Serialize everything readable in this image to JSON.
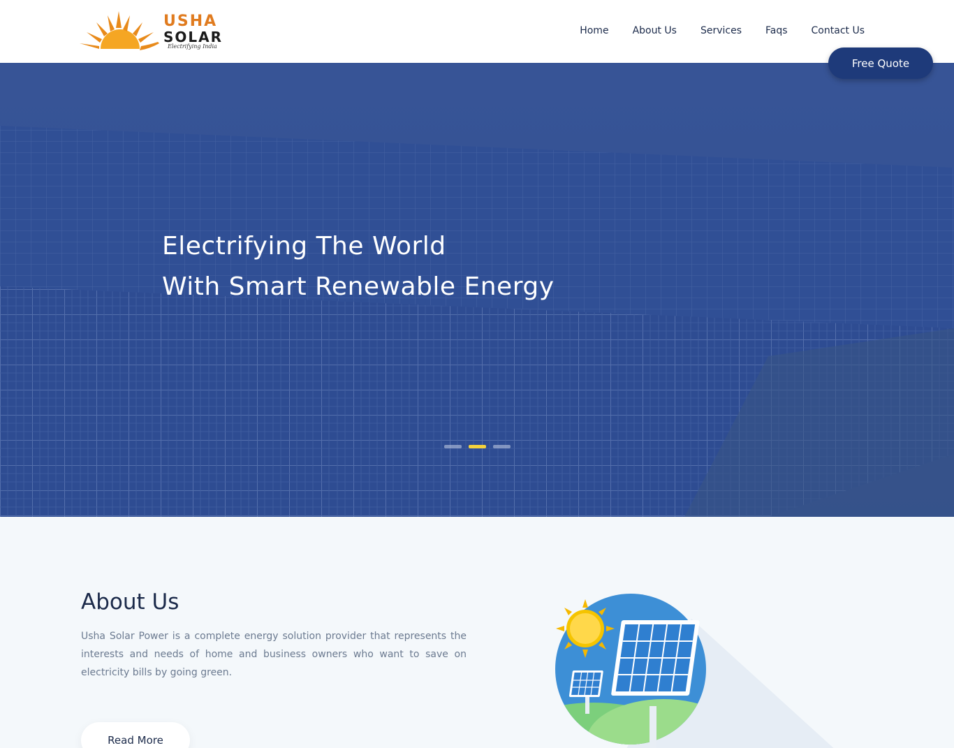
{
  "header": {
    "logo": {
      "brand_top": "USHA",
      "brand_bottom": "SOLAR",
      "tagline": "Electrifying India",
      "icon": "sun-logo-icon"
    },
    "nav": [
      {
        "label": "Home"
      },
      {
        "label": "About Us"
      },
      {
        "label": "Services"
      },
      {
        "label": "Faqs"
      },
      {
        "label": "Contact Us"
      }
    ],
    "quote_button": "Free Quote"
  },
  "hero": {
    "line1": "Electrifying The World",
    "line2": "With Smart Renewable Energy",
    "slides": 3,
    "active_slide": 2
  },
  "about": {
    "title": "About Us",
    "text": "Usha Solar Power is a complete energy solution provider that represents the interests and needs of home and business owners who want to save on electricity bills by going green.",
    "button": "Read More",
    "illustration": "solar-panel-illustration-icon"
  },
  "colors": {
    "brand_orange": "#e07b1f",
    "primary_blue": "#1e3a7a",
    "hero_overlay": "#2e4d8a",
    "active_dot": "#f4d23c"
  }
}
